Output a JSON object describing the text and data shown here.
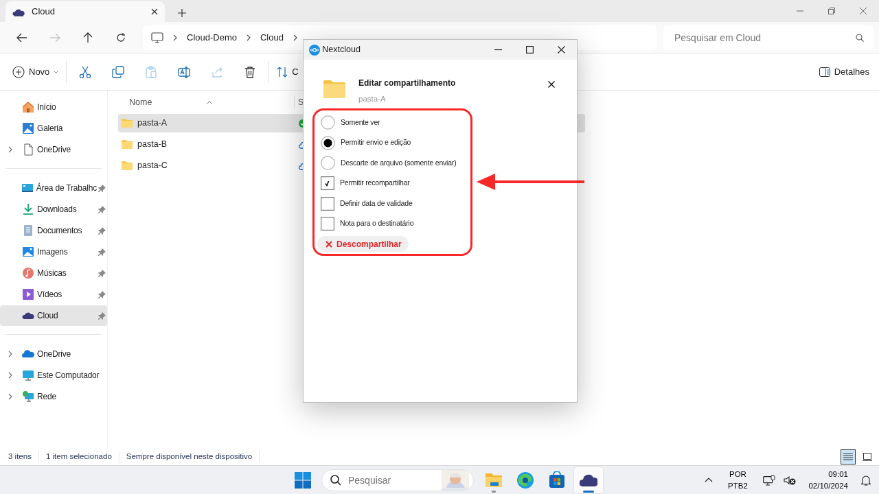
{
  "tab": {
    "title": "Cloud"
  },
  "nav_buttons": [
    {
      "kind": "back",
      "disabled": false
    },
    {
      "kind": "forward",
      "disabled": true
    },
    {
      "kind": "up",
      "disabled": false
    },
    {
      "kind": "refresh",
      "disabled": false
    }
  ],
  "breadcrumb": [
    "Cloud-Demo",
    "Cloud"
  ],
  "search": {
    "placeholder": "Pesquisar em Cloud"
  },
  "toolbar": {
    "new_label": "Novo",
    "buttons": [
      {
        "kind": "cut",
        "disabled": false
      },
      {
        "kind": "copy",
        "disabled": false
      },
      {
        "kind": "paste",
        "disabled": true
      },
      {
        "kind": "rename",
        "disabled": false
      },
      {
        "kind": "share",
        "disabled": true
      },
      {
        "kind": "delete",
        "disabled": false
      }
    ],
    "sort_label": "C",
    "details_label": "Detalhes"
  },
  "sidebar": {
    "groups": [
      [
        {
          "label": "Início",
          "kind": "home",
          "expandable": false,
          "pinned": false,
          "selected": false
        },
        {
          "label": "Galeria",
          "kind": "gallery",
          "expandable": false,
          "pinned": false,
          "selected": false
        },
        {
          "label": "OneDrive",
          "kind": "file",
          "expandable": true,
          "pinned": false,
          "selected": false
        }
      ],
      [
        {
          "label": "Área de Trabalhc",
          "kind": "desktop",
          "expandable": false,
          "pinned": true,
          "selected": false
        },
        {
          "label": "Downloads",
          "kind": "download",
          "expandable": false,
          "pinned": true,
          "selected": false
        },
        {
          "label": "Documentos",
          "kind": "documents",
          "expandable": false,
          "pinned": true,
          "selected": false
        },
        {
          "label": "Imagens",
          "kind": "pictures",
          "expandable": false,
          "pinned": true,
          "selected": false
        },
        {
          "label": "Músicas",
          "kind": "music",
          "expandable": false,
          "pinned": true,
          "selected": false
        },
        {
          "label": "Vídeos",
          "kind": "videos",
          "expandable": false,
          "pinned": true,
          "selected": false
        },
        {
          "label": "Cloud",
          "kind": "cloud",
          "expandable": false,
          "pinned": true,
          "selected": true
        }
      ],
      [
        {
          "label": "OneDrive",
          "kind": "onedrive",
          "expandable": true,
          "pinned": false,
          "selected": false
        },
        {
          "label": "Este Computador",
          "kind": "computer",
          "expandable": true,
          "pinned": false,
          "selected": false
        },
        {
          "label": "Rede",
          "kind": "network",
          "expandable": true,
          "pinned": false,
          "selected": false
        }
      ]
    ]
  },
  "columns": [
    "Nome",
    "S"
  ],
  "files": [
    {
      "name": "pasta-A",
      "selected": true,
      "synced": true
    },
    {
      "name": "pasta-B",
      "selected": false,
      "synced": false
    },
    {
      "name": "pasta-C",
      "selected": false,
      "synced": false
    }
  ],
  "status_bar": [
    "3 itens",
    "1 item selecionado",
    "Sempre disponível neste dispositivo"
  ],
  "view_buttons": [
    {
      "kind": "details",
      "selected": true
    },
    {
      "kind": "tiles",
      "selected": false
    }
  ],
  "dialog": {
    "title": "Nextcloud",
    "heading": "Editar compartilhamento",
    "subtitle": "pasta-A",
    "options": [
      {
        "kind": "radio",
        "label": "Somente ver",
        "checked": false
      },
      {
        "kind": "radio",
        "label": "Permitir envio e edição",
        "checked": true
      },
      {
        "kind": "radio",
        "label": "Descarte de arquivo (somente enviar)",
        "checked": false
      },
      {
        "kind": "checkbox",
        "label": "Permitir recompartilhar",
        "checked": true
      },
      {
        "kind": "checkbox",
        "label": "Definir data de validade",
        "checked": false
      },
      {
        "kind": "checkbox",
        "label": "Nota para o destinatário",
        "checked": false
      }
    ],
    "unshare_label": "Descompartilhar"
  },
  "taskbar": {
    "search_placeholder": "Pesquisar",
    "apps": [
      {
        "kind": "explorer",
        "running": true,
        "active": false
      },
      {
        "kind": "edge",
        "running": false,
        "active": false
      },
      {
        "kind": "store",
        "running": false,
        "active": false
      },
      {
        "kind": "cloud",
        "running": true,
        "active": true
      }
    ],
    "language": [
      "POR",
      "PTB2"
    ],
    "time": "09:01",
    "date": "02/10/2024"
  }
}
